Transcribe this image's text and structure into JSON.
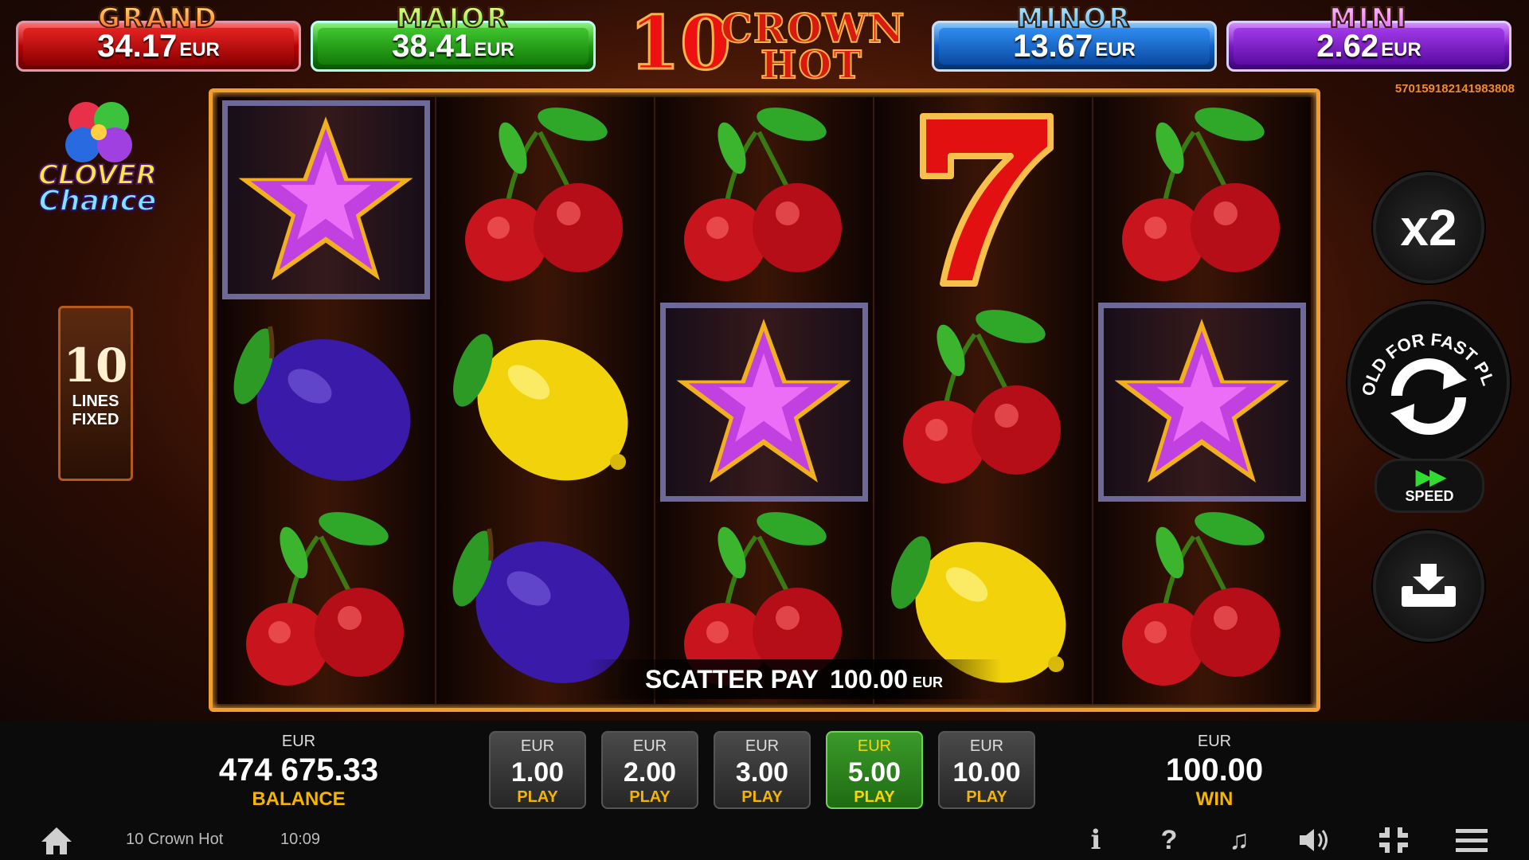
{
  "jackpots": {
    "grand": {
      "title": "GRAND",
      "value": "34.17",
      "currency": "EUR"
    },
    "major": {
      "title": "MAJOR",
      "value": "38.41",
      "currency": "EUR"
    },
    "minor": {
      "title": "MINOR",
      "value": "13.67",
      "currency": "EUR"
    },
    "mini": {
      "title": "MINI",
      "value": "2.62",
      "currency": "EUR"
    }
  },
  "logo": {
    "ten": "10",
    "crown": "CROWN",
    "hot": "HOT"
  },
  "ticket_id": "570159182141983808",
  "clover_logo": {
    "line1": "CLOVER",
    "line2": "Chance"
  },
  "lines_panel": {
    "number": "10",
    "line1": "LINES",
    "line2": "FIXED"
  },
  "reels": [
    [
      "star",
      "plum",
      "cherry"
    ],
    [
      "cherry",
      "lemon",
      "plum"
    ],
    [
      "cherry",
      "star",
      "cherry"
    ],
    [
      "seven",
      "cherry",
      "lemon"
    ],
    [
      "cherry",
      "star",
      "cherry"
    ]
  ],
  "highlighted": [
    "0-0",
    "2-1",
    "4-1"
  ],
  "scatter": {
    "label": "SCATTER PAY",
    "value": "100.00",
    "currency": "EUR"
  },
  "controls": {
    "multiplier": "x2",
    "spin_hint": "HOLD FOR FAST PLAY",
    "speed_label": "SPEED",
    "icons": [
      "spin-icon",
      "fast-forward-icon",
      "collect-icon"
    ]
  },
  "balance": {
    "currency": "EUR",
    "value": "474 675.33",
    "label": "BALANCE"
  },
  "bets": [
    {
      "currency": "EUR",
      "value": "1.00",
      "label": "PLAY",
      "selected": false
    },
    {
      "currency": "EUR",
      "value": "2.00",
      "label": "PLAY",
      "selected": false
    },
    {
      "currency": "EUR",
      "value": "3.00",
      "label": "PLAY",
      "selected": false
    },
    {
      "currency": "EUR",
      "value": "5.00",
      "label": "PLAY",
      "selected": true
    },
    {
      "currency": "EUR",
      "value": "10.00",
      "label": "PLAY",
      "selected": false
    }
  ],
  "win": {
    "currency": "EUR",
    "value": "100.00",
    "label": "WIN"
  },
  "footer": {
    "game_name": "10 Crown Hot",
    "time": "10:09",
    "icons": [
      "home-icon",
      "info-icon",
      "help-icon",
      "music-icon",
      "sound-icon",
      "fullscreen-icon",
      "menu-icon"
    ],
    "info_glyph": "i",
    "help_glyph": "?"
  },
  "colors": {
    "accent": "#f5b400",
    "selected_bet": "#3b9a2a",
    "frame": "#f0a030",
    "speed_arrow": "#2fdc2f"
  }
}
